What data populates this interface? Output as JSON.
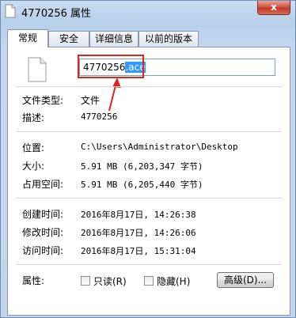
{
  "window": {
    "title": "4770256 属性",
    "close_label": "x"
  },
  "tabs": [
    {
      "label": "常规",
      "active": true
    },
    {
      "label": "安全",
      "active": false
    },
    {
      "label": "详细信息",
      "active": false
    },
    {
      "label": "以前的版本",
      "active": false
    }
  ],
  "general": {
    "name_base": "4770256",
    "name_ext_selected": ".ace",
    "file_type_label": "文件类型:",
    "file_type_value": "文件",
    "description_label": "描述:",
    "description_value": "4770256",
    "location_label": "位置:",
    "location_value": "C:\\Users\\Administrator\\Desktop",
    "size_label": "大小:",
    "size_value": "5.91 MB (6,203,347 字节)",
    "disk_size_label": "占用空间:",
    "disk_size_value": "5.91 MB (6,205,440 字节)",
    "created_label": "创建时间:",
    "created_value": "2016年8月17日, 14:26:38",
    "modified_label": "修改时间:",
    "modified_value": "2016年8月17日, 14:26:06",
    "accessed_label": "访问时间:",
    "accessed_value": "2016年8月17日, 15:31:04",
    "attributes_label": "属性:",
    "readonly_label": "只读(R)",
    "readonly_checked": false,
    "hidden_label": "隐藏(H)",
    "hidden_checked": false,
    "advanced_button": "高级(D)..."
  },
  "annotation": {
    "highlight_color": "#e0241b",
    "selection_color": "#3399ff"
  }
}
